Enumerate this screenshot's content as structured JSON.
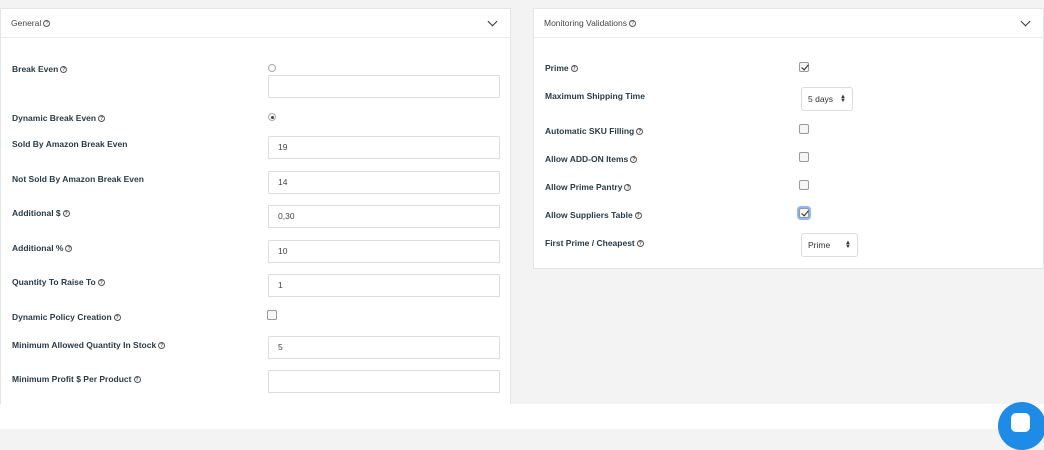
{
  "general": {
    "title": "General",
    "fields": {
      "break_even": {
        "label": "Break Even",
        "value": ""
      },
      "dynamic_break_even": {
        "label": "Dynamic Break Even"
      },
      "sold_by_amazon": {
        "label": "Sold By Amazon Break Even",
        "value": "19"
      },
      "not_sold_by_amazon": {
        "label": "Not Sold By Amazon Break Even",
        "value": "14"
      },
      "additional_dollar": {
        "label": "Additional $",
        "value": "0,30"
      },
      "additional_percent": {
        "label": "Additional %",
        "value": "10"
      },
      "quantity_raise": {
        "label": "Quantity To Raise To",
        "value": "1"
      },
      "dynamic_policy": {
        "label": "Dynamic Policy Creation"
      },
      "min_qty_stock": {
        "label": "Minimum Allowed Quantity In Stock",
        "value": "5"
      },
      "min_profit": {
        "label": "Minimum Profit $ Per Product",
        "value": ""
      }
    }
  },
  "monitoring": {
    "title": "Monitoring Validations",
    "fields": {
      "prime": {
        "label": "Prime"
      },
      "max_shipping": {
        "label": "Maximum Shipping Time",
        "value": "5 days"
      },
      "auto_sku": {
        "label": "Automatic SKU Filling"
      },
      "allow_addon": {
        "label": "Allow ADD-ON Items"
      },
      "allow_pantry": {
        "label": "Allow Prime Pantry"
      },
      "allow_suppliers": {
        "label": "Allow Suppliers Table"
      },
      "first_prime": {
        "label": "First Prime / Cheapest",
        "value": "Prime"
      }
    }
  },
  "icons": {
    "help": "?",
    "chevron": "chevron-down-icon",
    "chat": "chat-icon"
  },
  "colors": {
    "accent": "#1e8ce6",
    "focus": "#8fb7ee"
  }
}
